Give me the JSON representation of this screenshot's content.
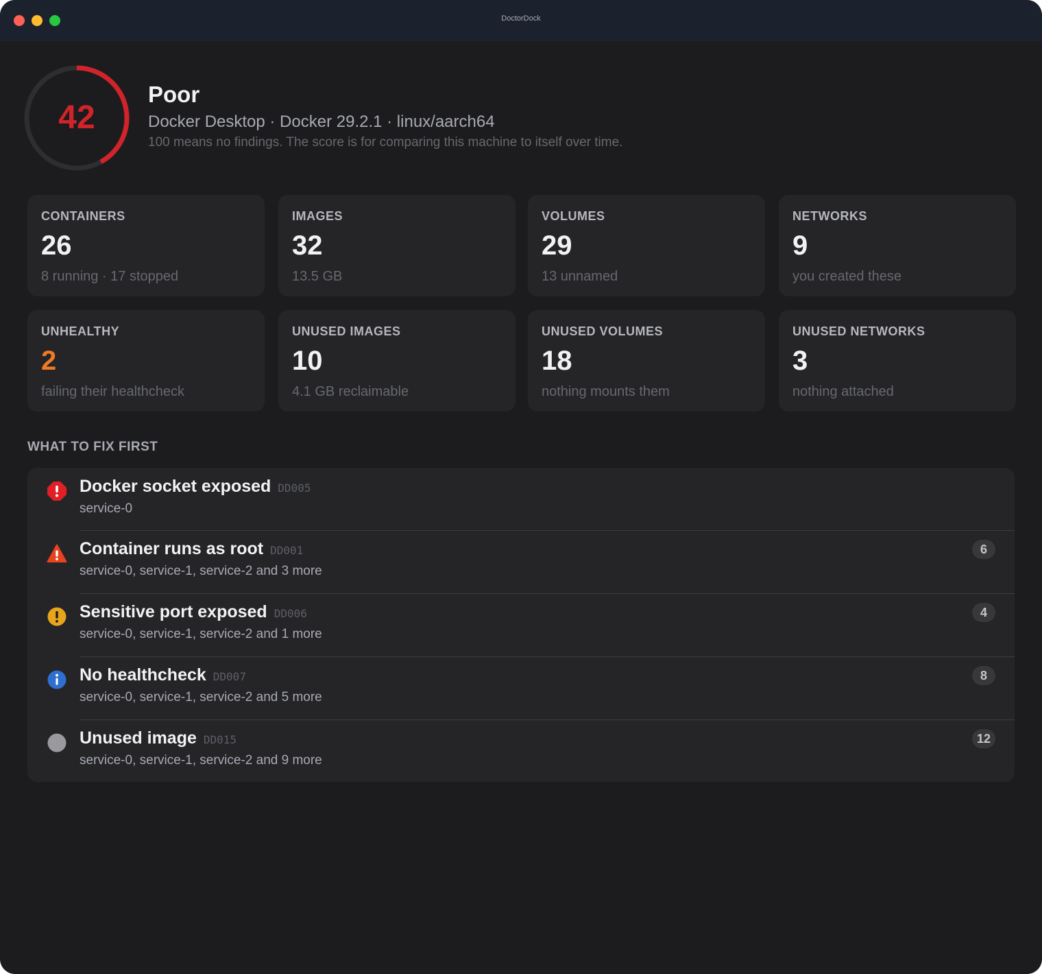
{
  "window": {
    "title": "DoctorDock"
  },
  "score": {
    "value": 42,
    "max": 100,
    "status": "Poor",
    "ring_color": "#d0242a",
    "track_color": "#2e2e31",
    "environment": "Docker Desktop · Docker 29.2.1 · linux/aarch64",
    "note": "100 means no findings. The score is for comparing this machine to itself over time."
  },
  "stats": [
    {
      "label": "CONTAINERS",
      "value": "26",
      "sub": "8 running · 17 stopped"
    },
    {
      "label": "IMAGES",
      "value": "32",
      "sub": "13.5 GB"
    },
    {
      "label": "VOLUMES",
      "value": "29",
      "sub": "13 unnamed"
    },
    {
      "label": "NETWORKS",
      "value": "9",
      "sub": "you created these"
    },
    {
      "label": "UNHEALTHY",
      "value": "2",
      "sub": "failing their healthcheck",
      "accent": "#f07a26"
    },
    {
      "label": "UNUSED IMAGES",
      "value": "10",
      "sub": "4.1 GB reclaimable"
    },
    {
      "label": "UNUSED VOLUMES",
      "value": "18",
      "sub": "nothing mounts them"
    },
    {
      "label": "UNUSED NETWORKS",
      "value": "3",
      "sub": "nothing attached"
    }
  ],
  "fix_section": {
    "title": "WHAT TO FIX FIRST",
    "items": [
      {
        "severity": "critical",
        "icon": "critical-icon",
        "color": "#e01f26",
        "title": "Docker socket exposed",
        "code": "DD005",
        "affected": "service-0",
        "count": ""
      },
      {
        "severity": "high",
        "icon": "warning-triangle-icon",
        "color": "#e8431f",
        "title": "Container runs as root",
        "code": "DD001",
        "affected": "service-0, service-1, service-2 and 3 more",
        "count": "6"
      },
      {
        "severity": "medium",
        "icon": "caution-icon",
        "color": "#e8a41c",
        "title": "Sensitive port exposed",
        "code": "DD006",
        "affected": "service-0, service-1, service-2 and 1 more",
        "count": "4"
      },
      {
        "severity": "info",
        "icon": "info-icon",
        "color": "#2e6fd0",
        "title": "No healthcheck",
        "code": "DD007",
        "affected": "service-0, service-1, service-2 and 5 more",
        "count": "8"
      },
      {
        "severity": "low",
        "icon": "dot-icon",
        "color": "#9a9a9e",
        "title": "Unused image",
        "code": "DD015",
        "affected": "service-0, service-1, service-2 and 9 more",
        "count": "12"
      }
    ]
  }
}
